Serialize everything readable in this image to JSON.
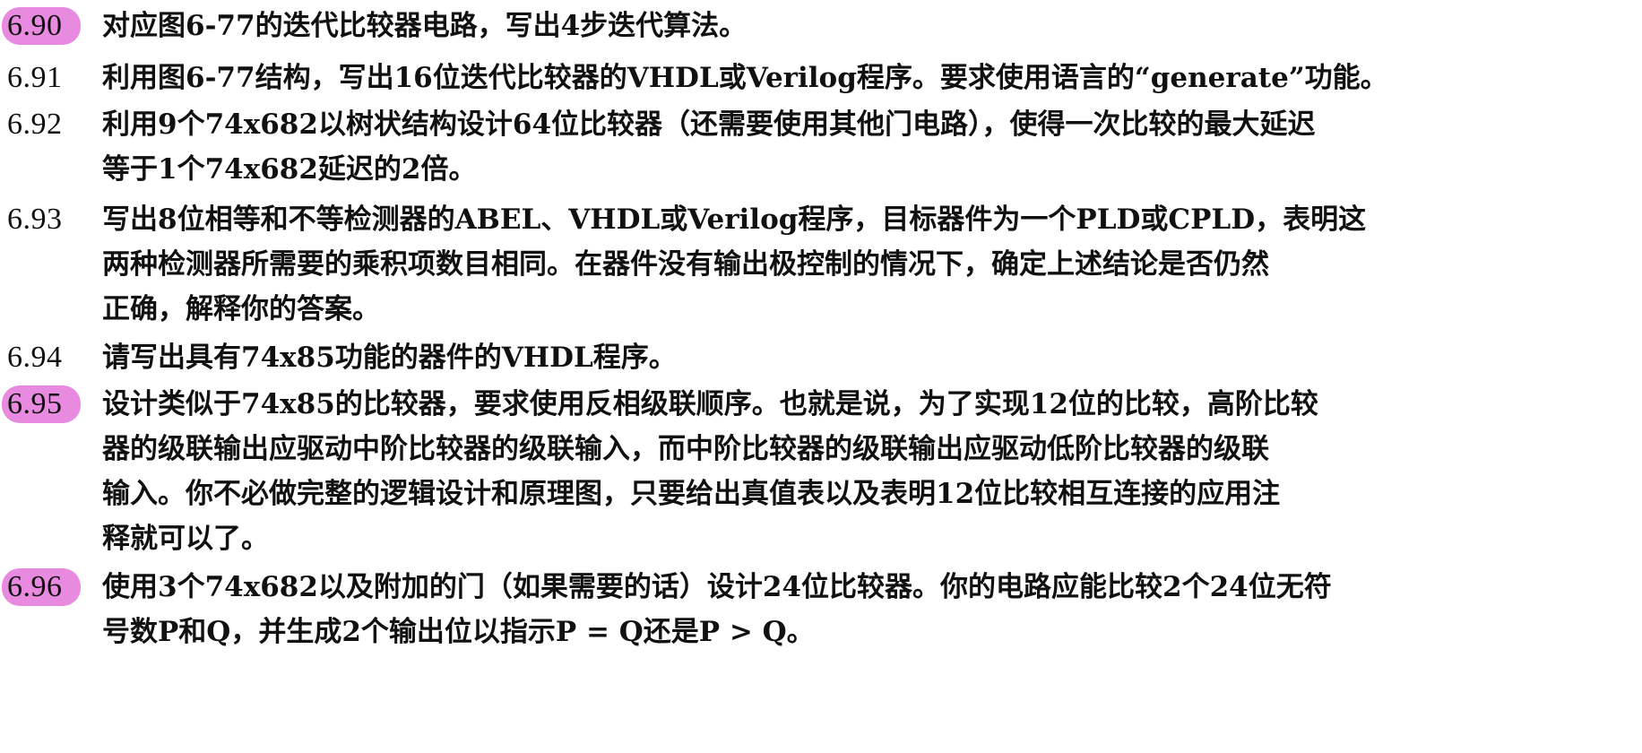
{
  "problems": [
    {
      "number": "6.90",
      "highlighted": true,
      "lines": [
        "对应图6-77的迭代比较器电路，写出4步迭代算法。"
      ]
    },
    {
      "number": "6.91",
      "highlighted": false,
      "lines": [
        "利用图6-77结构，写出16位迭代比较器的VHDL或Verilog程序。要求使用语言的“generate”功能。"
      ]
    },
    {
      "number": "6.92",
      "highlighted": false,
      "lines": [
        "利用9个74x682以树状结构设计64位比较器（还需要使用其他门电路），使得一次比较的最大延迟",
        "等于1个74x682延迟的2倍。"
      ]
    },
    {
      "number": "6.93",
      "highlighted": false,
      "lines": [
        "写出8位相等和不等检测器的ABEL、VHDL或Verilog程序，目标器件为一个PLD或CPLD，表明这",
        "两种检测器所需要的乘积项数目相同。在器件没有输出极控制的情况下，确定上述结论是否仍然",
        "正确，解释你的答案。"
      ]
    },
    {
      "number": "6.94",
      "highlighted": false,
      "lines": [
        "请写出具有74x85功能的器件的VHDL程序。"
      ]
    },
    {
      "number": "6.95",
      "highlighted": true,
      "lines": [
        "设计类似于74x85的比较器，要求使用反相级联顺序。也就是说，为了实现12位的比较，高阶比较",
        "器的级联输出应驱动中阶比较器的级联输入，而中阶比较器的级联输出应驱动低阶比较器的级联",
        "输入。你不必做完整的逻辑设计和原理图，只要给出真值表以及表明12位比较相互连接的应用注",
        "释就可以了。"
      ]
    },
    {
      "number": "6.96",
      "highlighted": true,
      "lines": [
        "使用3个74x682以及附加的门（如果需要的话）设计24位比较器。你的电路应能比较2个24位无符",
        "号数P和Q，并生成2个输出位以指示P = Q还是P > Q。"
      ]
    }
  ],
  "colors": {
    "highlight": "#e88ae0",
    "text": "#111111",
    "background": "#ffffff"
  }
}
